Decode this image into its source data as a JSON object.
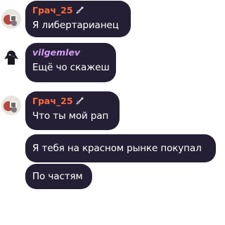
{
  "messages": [
    {
      "author": "Грач_25",
      "text": "Я либертарианец"
    },
    {
      "author": "vilgemlev",
      "text": "Ещё чо скажеш"
    },
    {
      "author": "Грач_25",
      "text": "Что ты мой рап"
    },
    {
      "text": "Я тебя на красном рынке покупал"
    },
    {
      "text": "По частям"
    }
  ],
  "colors": {
    "bubble_bg": "#241f34",
    "author_orange": "#ff6a3d",
    "author_purple": "#d59cf2",
    "text": "#ffffff"
  }
}
